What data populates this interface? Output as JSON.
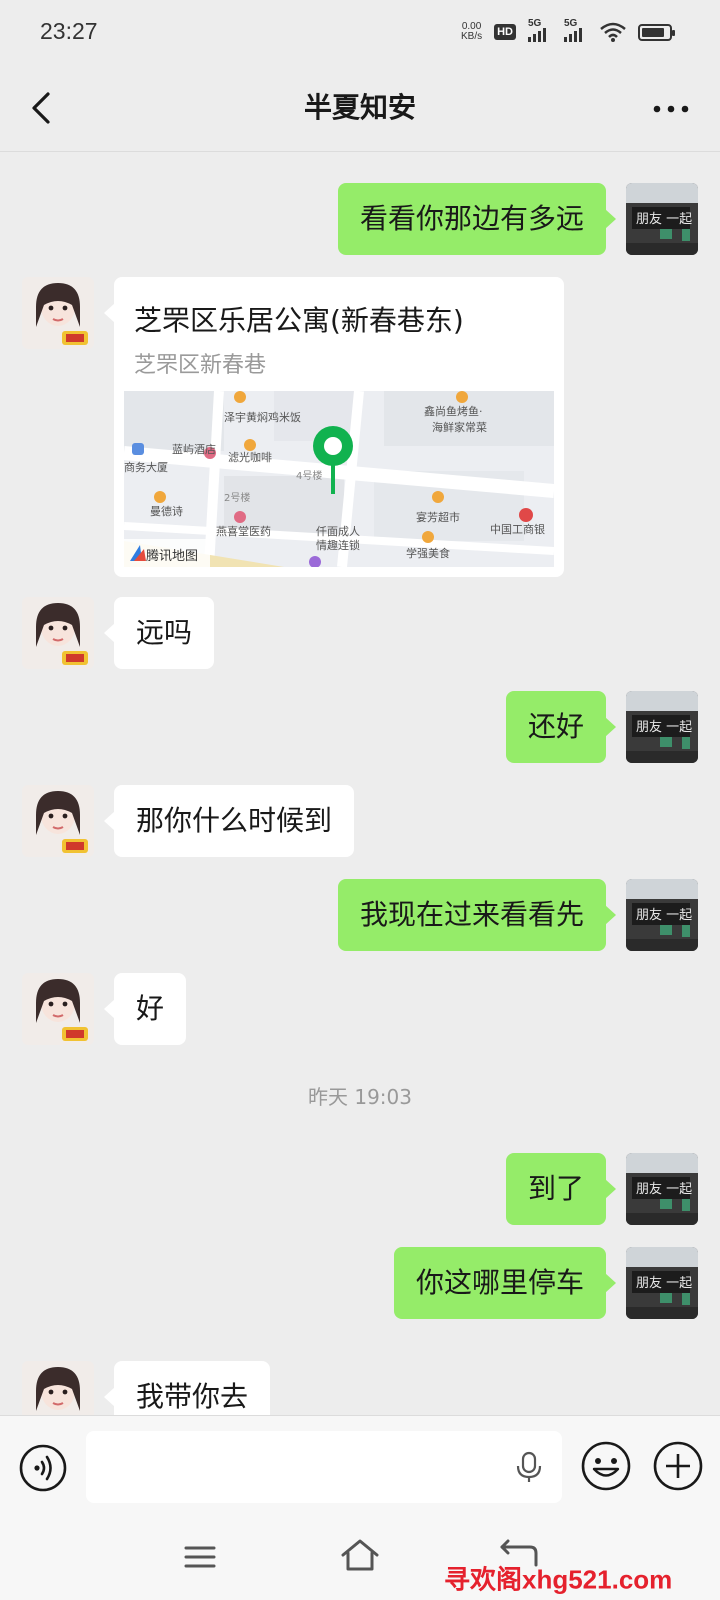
{
  "status": {
    "time": "23:27",
    "net_speed_value": "0.00",
    "net_speed_unit": "KB/s",
    "hd_label": "HD",
    "sim1_label": "5G",
    "sim2_label": "5G",
    "battery_level": 0.85
  },
  "header": {
    "title": "半夏知安",
    "back_icon": "chevron-left-icon",
    "more_icon": "more-dots-icon"
  },
  "messages": [
    {
      "side": "out",
      "text": "看看你那边有多远"
    },
    {
      "side": "in",
      "type": "location",
      "title": "芝罘区乐居公寓(新春巷东)",
      "subtitle": "芝罘区新春巷",
      "map": {
        "provider": "腾讯地图",
        "pois": [
          "泽宇黄焖鸡米饭",
          "鑫尚鱼烤鱼·",
          "海鲜家常菜",
          "蓝屿酒店",
          "滤光咖啡",
          "商务大厦",
          "4号楼",
          "2号楼",
          "曼德诗",
          "宴芳超市",
          "中国工商银",
          "燕喜堂医药",
          "仟面成人",
          "情趣连锁",
          "学强美食"
        ]
      }
    },
    {
      "side": "in",
      "text": "远吗"
    },
    {
      "side": "out",
      "text": "还好"
    },
    {
      "side": "in",
      "text": "那你什么时候到"
    },
    {
      "side": "out",
      "text": "我现在过来看看先"
    },
    {
      "side": "in",
      "text": "好"
    },
    {
      "type": "timestamp",
      "text": "昨天 19:03"
    },
    {
      "side": "out",
      "text": "到了"
    },
    {
      "side": "out",
      "text": "你这哪里停车"
    },
    {
      "side": "in",
      "text": "我带你去"
    }
  ],
  "input": {
    "placeholder": ""
  },
  "watermark": "寻欢阁xhg521.com"
}
